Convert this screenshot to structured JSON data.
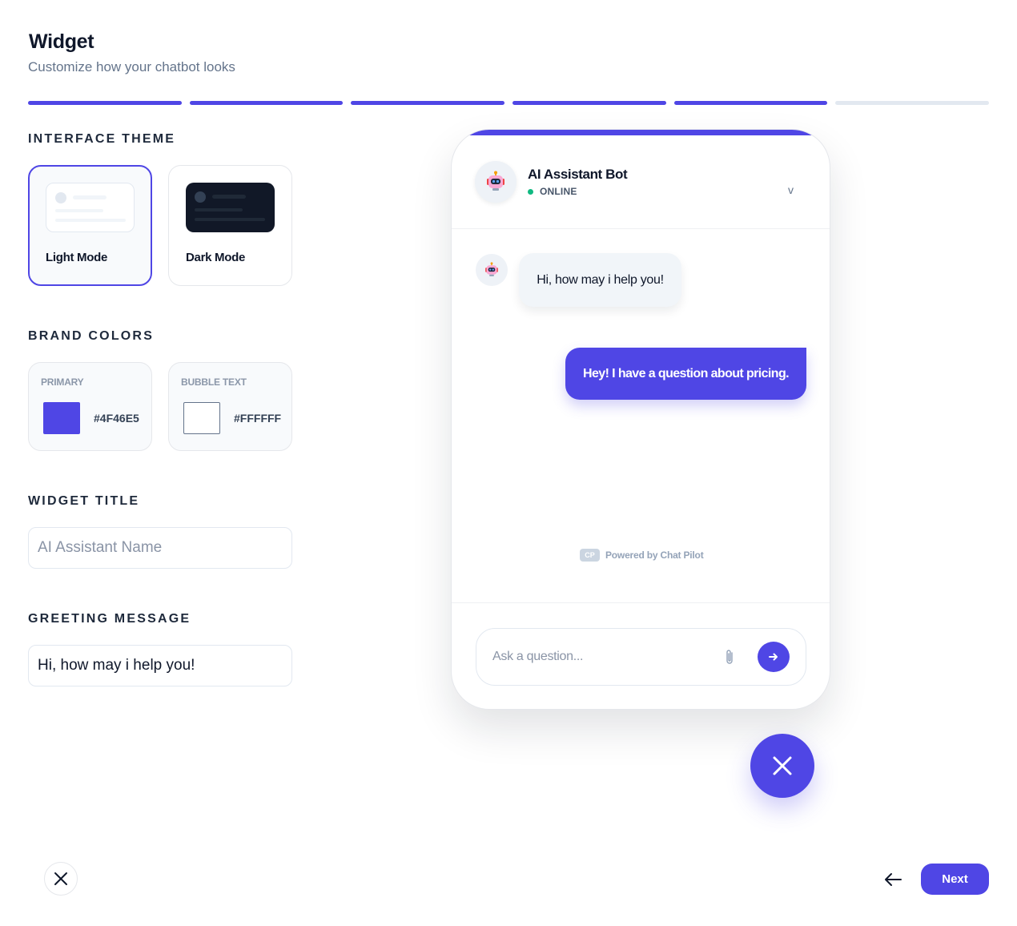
{
  "header": {
    "title": "Widget",
    "subtitle": "Customize how your chatbot looks"
  },
  "progress": {
    "total_steps": 6,
    "completed_steps": 5,
    "accent_color": "#4F46E5"
  },
  "sections": {
    "interface_theme": "INTERFACE THEME",
    "brand_colors": "BRAND COLORS",
    "widget_title": "WIDGET TITLE",
    "greeting_message": "GREETING MESSAGE"
  },
  "themes": [
    {
      "label": "Light Mode",
      "selected": true
    },
    {
      "label": "Dark Mode",
      "selected": false
    }
  ],
  "colors": {
    "primary": {
      "label": "PRIMARY",
      "value": "#4F46E5"
    },
    "bubble_text": {
      "label": "BUBBLE TEXT",
      "value": "#FFFFFF"
    }
  },
  "inputs": {
    "widget_title": {
      "value": "",
      "placeholder": "AI Assistant Name"
    },
    "greeting_message": {
      "value": "Hi, how may i help you!",
      "placeholder": ""
    }
  },
  "preview": {
    "bot_name": "AI Assistant Bot",
    "status": "ONLINE",
    "chevron": "v",
    "bot_message": "Hi, how may i help you!",
    "user_message": "Hey! I have a question about pricing.",
    "powered_badge": "CP",
    "powered_text": "Powered by Chat Pilot",
    "ask_placeholder": "Ask a question...",
    "icons": [
      "robot-icon",
      "paperclip-icon",
      "arrow-right-icon"
    ]
  },
  "footer": {
    "next_label": "Next",
    "icons": [
      "close-icon",
      "arrow-left-icon"
    ]
  }
}
